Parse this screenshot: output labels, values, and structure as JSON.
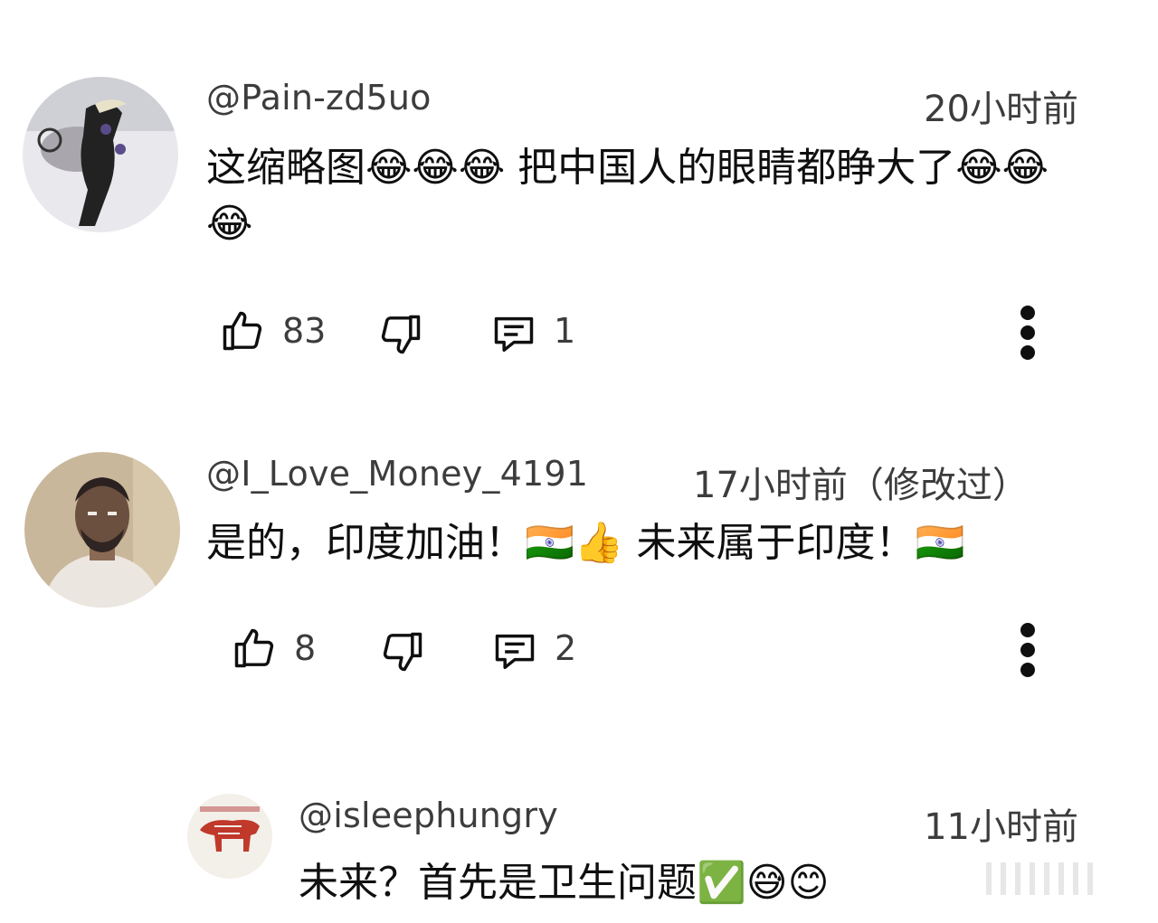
{
  "comments": [
    {
      "handle": "@Pain-zd5uo",
      "time": "20小时前",
      "text": "这缩略图😂😂😂 把中国人的眼睛都睁大了😂😂😂",
      "likes": "83",
      "replies": "1"
    },
    {
      "handle": "@I_Love_Money_4191",
      "time": "17小时前（修改过）",
      "text": "是的，印度加油！🇮🇳👍 未来属于印度！🇮🇳",
      "likes": "8",
      "replies": "2"
    },
    {
      "handle": "@isleephungry",
      "time": "11小时前",
      "text": "未来？首先是卫生问题✅😅😊"
    }
  ],
  "icons": {
    "like": "thumbs-up-icon",
    "dislike": "thumbs-down-icon",
    "reply": "comment-icon",
    "more": "more-vertical-icon"
  }
}
